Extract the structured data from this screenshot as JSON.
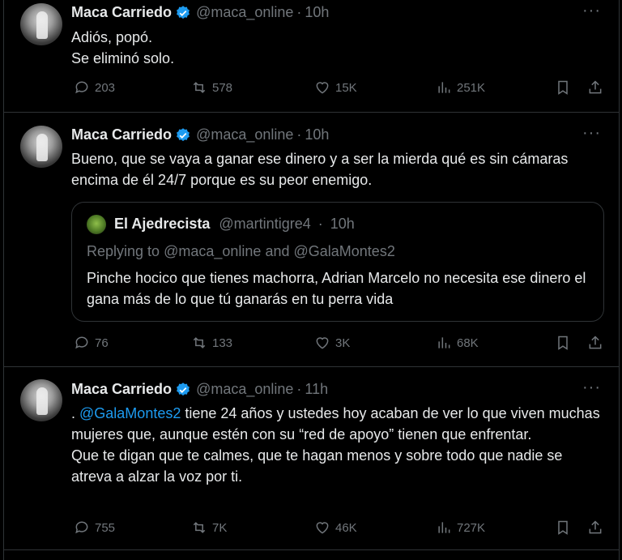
{
  "tweets": [
    {
      "name": "Maca Carriedo",
      "handle": "@maca_online",
      "time": "10h",
      "text": "Adiós, popó.\nSe eliminó solo.",
      "replies": "203",
      "retweets": "578",
      "likes": "15K",
      "views": "251K"
    },
    {
      "name": "Maca Carriedo",
      "handle": "@maca_online",
      "time": "10h",
      "text": "Bueno, que se vaya a ganar ese dinero y a ser la mierda qué es sin cámaras encima de él 24/7 porque es su peor enemigo.",
      "quote": {
        "name": "El Ajedrecista",
        "handle": "@martintigre4",
        "time": "10h",
        "replying_label": "Replying to",
        "replying_to_1": "@maca_online",
        "replying_and": "and",
        "replying_to_2": "@GalaMontes2",
        "text": "Pinche hocico que tienes machorra, Adrian Marcelo no necesita ese dinero el gana más de lo que tú ganarás en tu perra vida"
      },
      "replies": "76",
      "retweets": "133",
      "likes": "3K",
      "views": "68K"
    },
    {
      "name": "Maca Carriedo",
      "handle": "@maca_online",
      "time": "11h",
      "text_prefix": ". ",
      "text_mention": "@GalaMontes2",
      "text": " tiene 24 años y ustedes hoy acaban de ver lo que viven muchas mujeres que, aunque estén con su “red de apoyo” tienen que enfrentar.\nQue te digan que te calmes, que te hagan menos y sobre todo que nadie se atreva a alzar la voz por ti.",
      "replies": "755",
      "retweets": "7K",
      "likes": "46K",
      "views": "727K"
    }
  ],
  "separator": "·",
  "more_glyph": "···",
  "colors": {
    "accent": "#1d9bf0",
    "muted": "#71767b",
    "text": "#e7e9ea",
    "border": "#2f3336"
  }
}
